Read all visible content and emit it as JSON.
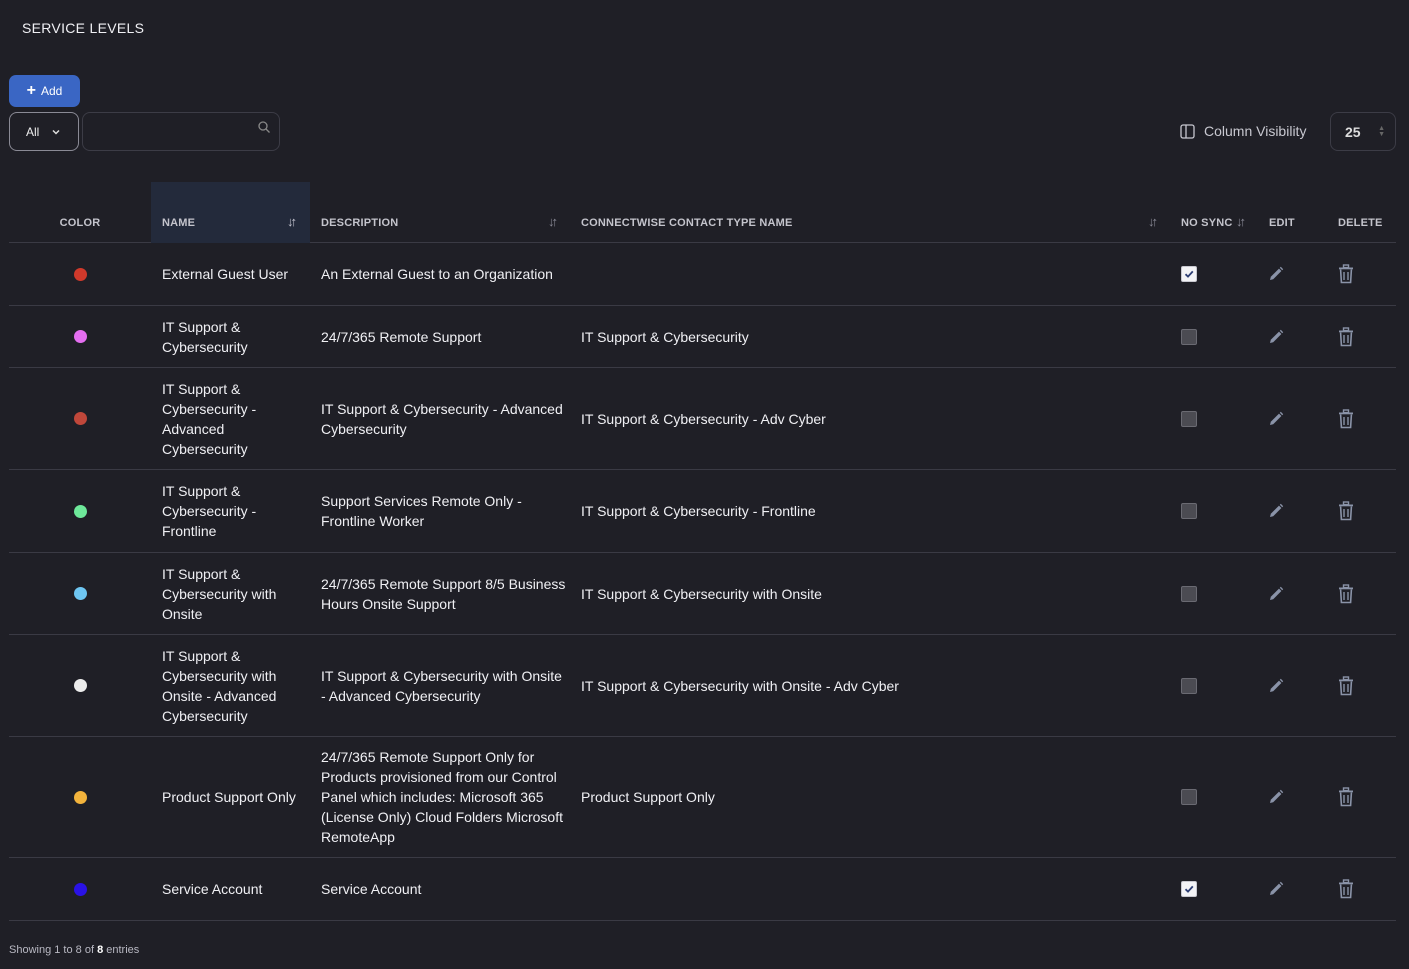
{
  "page": {
    "title": "SERVICE LEVELS"
  },
  "toolbar": {
    "add_label": "Add",
    "filter_value": "All",
    "search_value": "",
    "column_visibility_label": "Column Visibility",
    "page_size": "25"
  },
  "table": {
    "headers": {
      "color": "COLOR",
      "name": "NAME",
      "description": "DESCRIPTION",
      "contact_type": "CONNECTWISE CONTACT TYPE NAME",
      "no_sync": "NO SYNC",
      "edit": "EDIT",
      "delete": "DELETE"
    },
    "rows": [
      {
        "color": "#d0392b",
        "name": "External Guest User",
        "description": "An External Guest to an Organization",
        "contact_type": "",
        "no_sync": true
      },
      {
        "color": "#e46ef0",
        "name": "IT Support & Cybersecurity",
        "description": "24/7/365 Remote Support",
        "contact_type": "IT Support & Cybersecurity",
        "no_sync": false
      },
      {
        "color": "#c0473a",
        "name": "IT Support & Cybersecurity - Advanced Cybersecurity",
        "description": "IT Support & Cybersecurity - Advanced Cybersecurity",
        "contact_type": "IT Support & Cybersecurity - Adv Cyber",
        "no_sync": false
      },
      {
        "color": "#6ee89a",
        "name": "IT Support & Cybersecurity - Frontline",
        "description": "Support Services Remote Only - Frontline Worker",
        "contact_type": "IT Support & Cybersecurity - Frontline",
        "no_sync": false
      },
      {
        "color": "#6ec6f2",
        "name": "IT Support & Cybersecurity with Onsite",
        "description": "24/7/365 Remote Support 8/5 Business Hours Onsite Support",
        "contact_type": "IT Support & Cybersecurity with Onsite",
        "no_sync": false
      },
      {
        "color": "#ececec",
        "name": "IT Support & Cybersecurity with Onsite - Advanced Cybersecurity",
        "description": "IT Support & Cybersecurity with Onsite - Advanced Cybersecurity",
        "contact_type": "IT Support & Cybersecurity with Onsite - Adv Cyber",
        "no_sync": false
      },
      {
        "color": "#f2b33c",
        "name": "Product Support Only",
        "description": "24/7/365 Remote Support Only for Products provisioned from our Control Panel which includes: Microsoft 365 (License Only) Cloud Folders Microsoft RemoteApp",
        "contact_type": "Product Support Only",
        "no_sync": false
      },
      {
        "color": "#2a12e6",
        "name": "Service Account",
        "description": "Service Account",
        "contact_type": "",
        "no_sync": true
      }
    ]
  },
  "footer": {
    "prefix": "Showing 1 to 8 of",
    "total": "8",
    "suffix": "entries"
  }
}
